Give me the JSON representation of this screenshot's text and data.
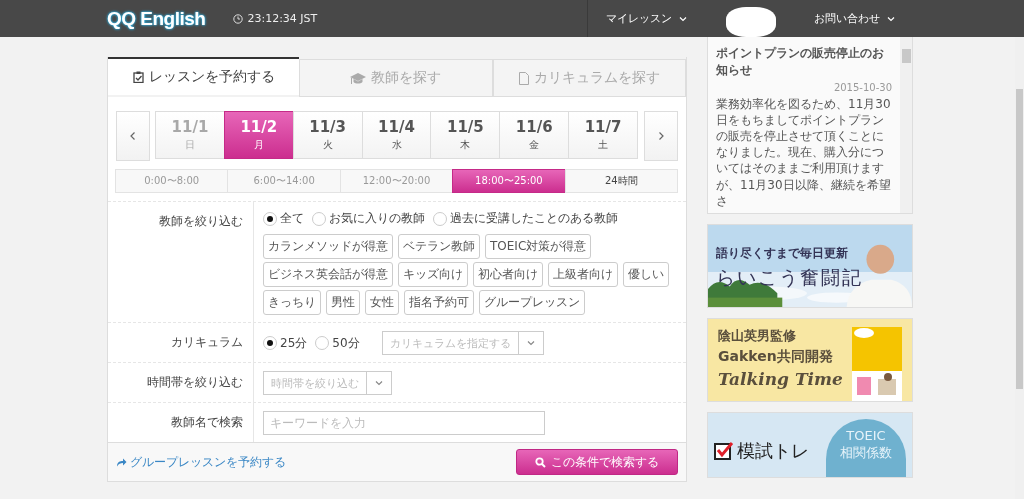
{
  "header": {
    "logo": "QQ English",
    "time": "23:12:34 JST",
    "nav": [
      {
        "label": "マイレッスン"
      },
      {
        "label": "お問い合わせ"
      }
    ]
  },
  "tabs": [
    {
      "label": "レッスンを予約する",
      "selected": true
    },
    {
      "label": "教師を探す",
      "selected": false
    },
    {
      "label": "カリキュラムを探す",
      "selected": false
    }
  ],
  "dates": [
    {
      "date": "11/1",
      "day": "日",
      "selected": false,
      "disabled": true
    },
    {
      "date": "11/2",
      "day": "月",
      "selected": true,
      "disabled": false
    },
    {
      "date": "11/3",
      "day": "火",
      "selected": false,
      "disabled": false
    },
    {
      "date": "11/4",
      "day": "水",
      "selected": false,
      "disabled": false
    },
    {
      "date": "11/5",
      "day": "木",
      "selected": false,
      "disabled": false
    },
    {
      "date": "11/6",
      "day": "金",
      "selected": false,
      "disabled": false
    },
    {
      "date": "11/7",
      "day": "土",
      "selected": false,
      "disabled": false
    }
  ],
  "time_ranges": [
    {
      "label": "0:00〜8:00",
      "selected": false
    },
    {
      "label": "6:00〜14:00",
      "selected": false
    },
    {
      "label": "12:00〜20:00",
      "selected": false
    },
    {
      "label": "18:00〜25:00",
      "selected": true
    },
    {
      "label": "24時間",
      "selected": false
    }
  ],
  "teacher_filter": {
    "label": "教師を絞り込む",
    "options": [
      {
        "label": "全て",
        "selected": true
      },
      {
        "label": "お気に入りの教師",
        "selected": false
      },
      {
        "label": "過去に受講したことのある教師",
        "selected": false
      }
    ],
    "tags": [
      "カランメソッドが得意",
      "ベテラン教師",
      "TOEIC対策が得意",
      "ビジネス英会話が得意",
      "キッズ向け",
      "初心者向け",
      "上級者向け",
      "優しい",
      "きっちり",
      "男性",
      "女性",
      "指名予約可",
      "グループレッスン"
    ]
  },
  "curriculum": {
    "label": "カリキュラム",
    "options": [
      {
        "label": "25分",
        "selected": true
      },
      {
        "label": "50分",
        "selected": false
      }
    ],
    "placeholder": "カリキュラムを指定する"
  },
  "time_filter": {
    "label": "時間帯を絞り込む",
    "placeholder": "時間帯を絞り込む"
  },
  "name_search": {
    "label": "教師名で検索",
    "placeholder": "キーワードを入力"
  },
  "group_link": "グループレッスンを予約する",
  "search_button": "この条件で検索する",
  "news": {
    "title": "ポイントプランの販売停止のお知らせ",
    "date": "2015-10-30",
    "body": "業務効率化を図るため、11月30日をもちましてポイントプランの販売を停止させて頂くことになりました。現在、購入分についてはそのままご利用頂けますが、11月30日以降、継続を希望さ"
  },
  "banners": [
    {
      "kind": "blog",
      "tagline": "語り尽くすまで毎日更新",
      "title": "らいこう奮闘記"
    },
    {
      "kind": "book",
      "lines": [
        "陰山英男監修",
        "Gakken共同開発",
        "Talking Time"
      ]
    },
    {
      "kind": "exam",
      "title": "模試トレ",
      "badge": [
        "TOEIC",
        "相関係数"
      ]
    }
  ]
}
